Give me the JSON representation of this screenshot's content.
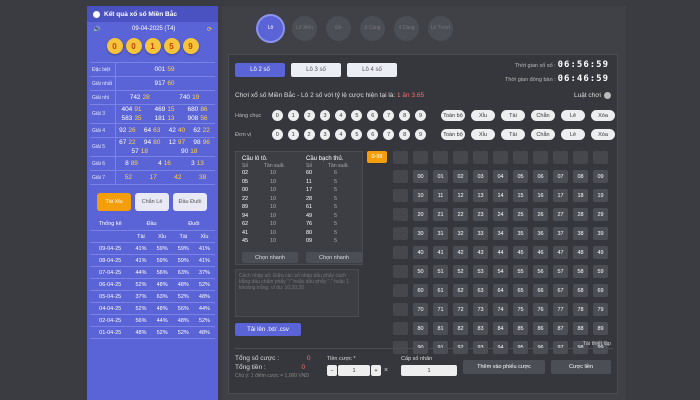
{
  "left": {
    "header": "Kết quả xổ số Miền Bắc",
    "date": "09-04-2025 (T4)",
    "balls": [
      "0",
      "0",
      "1",
      "5",
      "9"
    ],
    "results": [
      {
        "label": "Đặc biệt",
        "values": [
          "00159"
        ]
      },
      {
        "label": "Giải nhất",
        "values": [
          "91760"
        ]
      },
      {
        "label": "Giải nhì",
        "values": [
          "74228",
          "74019"
        ]
      },
      {
        "label": "Giải 3",
        "values": [
          "40491",
          "46915",
          "68086",
          "58335",
          "18113",
          "90856"
        ]
      },
      {
        "label": "Giải 4",
        "values": [
          "9226",
          "6463",
          "4240",
          "6222"
        ]
      },
      {
        "label": "Giải 5",
        "values": [
          "6722",
          "9480",
          "1297",
          "9896",
          "5718",
          "9018"
        ]
      },
      {
        "label": "Giải 6",
        "values": [
          "889",
          "416",
          "313"
        ]
      },
      {
        "label": "Giải 7",
        "values": [
          "52",
          "17",
          "42",
          "38"
        ]
      }
    ],
    "tabs": [
      "Tài Xỉu",
      "Chẵn Lẻ",
      "Đầu Đuôi"
    ],
    "stats": {
      "title": "Thống kê",
      "head": "Đầu",
      "tail": "Đuôi",
      "sub": [
        "Tài",
        "Xỉu",
        "Tài",
        "Xỉu"
      ],
      "rows": [
        [
          "09-04-25",
          "41%",
          "59%",
          "59%",
          "41%"
        ],
        [
          "08-04-25",
          "41%",
          "59%",
          "59%",
          "41%"
        ],
        [
          "07-04-25",
          "44%",
          "56%",
          "63%",
          "37%"
        ],
        [
          "06-04-25",
          "52%",
          "48%",
          "48%",
          "52%"
        ],
        [
          "05-04-25",
          "37%",
          "63%",
          "52%",
          "48%"
        ],
        [
          "04-04-25",
          "52%",
          "48%",
          "56%",
          "44%"
        ],
        [
          "02-04-25",
          "56%",
          "44%",
          "48%",
          "52%"
        ],
        [
          "01-04-25",
          "48%",
          "52%",
          "52%",
          "48%"
        ]
      ]
    }
  },
  "nav": [
    "Lô",
    "Lô Xiên",
    "Đề",
    "3 Càng",
    "4 Càng",
    "Lô Trượt"
  ],
  "game": {
    "tabs": [
      "Lô 2 số",
      "Lô 3 số",
      "Lô 4 số"
    ],
    "time_label": "Thời gian xổ số :",
    "time": "06:56:59",
    "close_label": "Thời gian đóng bàn :",
    "close": "06:46:59",
    "desc": "Chơi xổ số Miền Bắc - Lô 2 số với tỷ lệ cược hiện tại là:",
    "odds": "1 ăn 3.65",
    "rules": "Luật chơi",
    "row_labels": [
      "Hàng chục",
      "Đơn vị"
    ],
    "digits": [
      "0",
      "1",
      "2",
      "3",
      "4",
      "5",
      "6",
      "7",
      "8",
      "9"
    ],
    "quick": [
      "Toàn bộ",
      "Xỉu",
      "Tài",
      "Chẵn",
      "Lẻ",
      "Xóa"
    ],
    "lo_to_title": "Cầu lô tô.",
    "bach_thu_title": "Cầu bạch thủ.",
    "col_so": "Số",
    "col_tan": "Tần suất.",
    "lo_to": [
      [
        "02",
        "10"
      ],
      [
        "05",
        "10"
      ],
      [
        "00",
        "10"
      ],
      [
        "22",
        "10"
      ],
      [
        "89",
        "10"
      ],
      [
        "94",
        "10"
      ],
      [
        "62",
        "10"
      ],
      [
        "41",
        "10"
      ],
      [
        "45",
        "10"
      ]
    ],
    "bach_thu": [
      [
        "60",
        "6"
      ],
      [
        "11",
        "5"
      ],
      [
        "17",
        "5"
      ],
      [
        "28",
        "5"
      ],
      [
        "61",
        "5"
      ],
      [
        "49",
        "5"
      ],
      [
        "76",
        "5"
      ],
      [
        "80",
        "5"
      ],
      [
        "09",
        "5"
      ]
    ],
    "quick_pick": "Chọn nhanh",
    "range": "0-99",
    "textarea_placeholder": "Cách nhập số: Giữa các số nhập dấu phẩy cách bằng dấu chấm phẩy \";\" hoặc dấu phẩy \",\" hoặc 1 khoảng trắng. ví dụ: 10,20,30",
    "upload": "Tải lên .txt/ .csv",
    "detail": "Tài thiết lập",
    "total_bet_label": "Tổng số cược :",
    "total_bet": "0",
    "total_money_label": "Tổng tiền :",
    "total_money": "0",
    "note": "Chú ý: 1 điểm cược = 1,000 VND",
    "stake_label": "Tiền cược *",
    "stake": "1",
    "mult_label": "Cấp số nhân",
    "mult": "1",
    "add_btn": "Thêm vào phiếu cược",
    "bet_btn": "Cược liền"
  }
}
